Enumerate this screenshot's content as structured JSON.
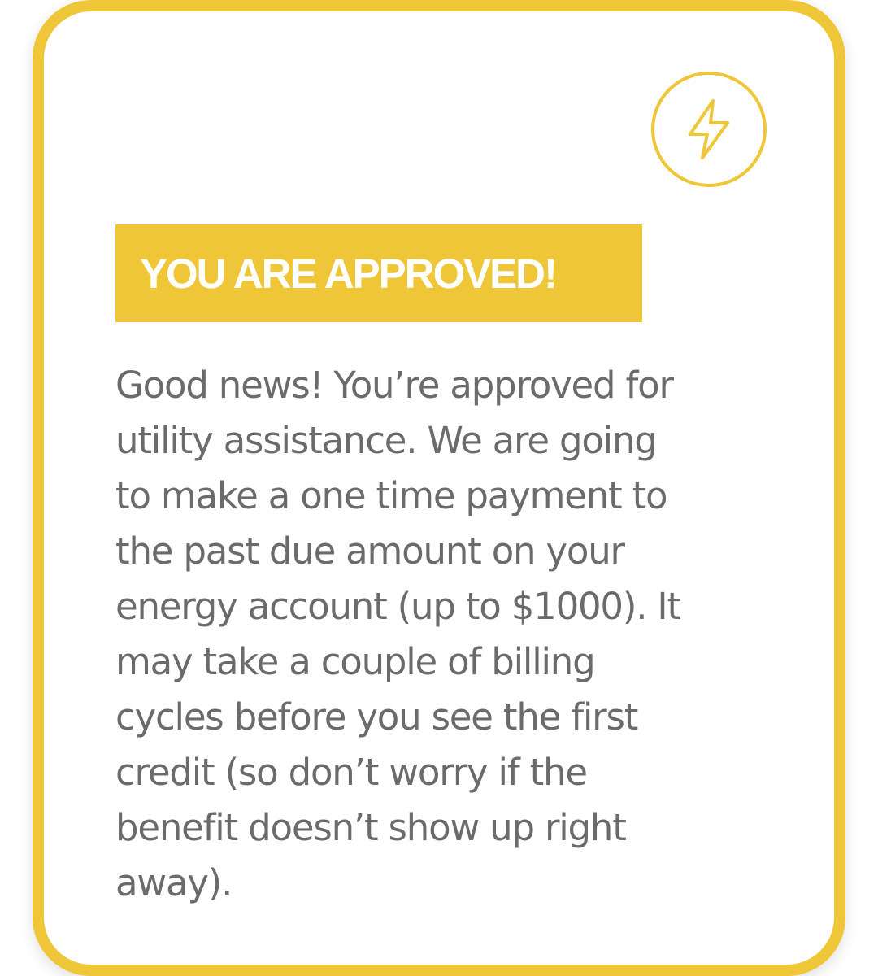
{
  "card": {
    "icon": "lightning-bolt-icon",
    "banner_title": "YOU ARE APPROVED!",
    "message_lines": [
      "Good news! You’re approved for",
      "utility assistance. We are going",
      "to make a one time payment to",
      "the past due amount on your",
      "energy account (up to $1000). It",
      "may take a couple of billing",
      "cycles before you see the first",
      "credit (so don’t worry if the",
      "benefit doesn’t show up right",
      "away)."
    ]
  },
  "colors": {
    "accent": "#EEC637",
    "body_text": "#6b6b6b",
    "background": "#ffffff"
  }
}
